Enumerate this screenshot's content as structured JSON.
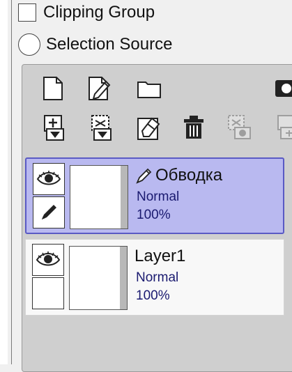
{
  "options": {
    "clipping_group": {
      "label": "Clipping Group",
      "checked": false
    },
    "selection_source": {
      "label": "Selection Source",
      "selected": false
    }
  },
  "toolbar": {
    "row1": [
      "new-layer-icon",
      "new-linework-layer-icon",
      "new-folder-icon",
      "mask-icon"
    ],
    "row2": [
      "transfer-down-icon",
      "merge-down-icon",
      "clear-layer-icon",
      "delete-layer-icon",
      "apply-mask-icon",
      "add-mask-icon"
    ]
  },
  "layers": [
    {
      "name": "Обводка",
      "mode": "Normal",
      "opacity": "100%",
      "selected": true,
      "visible": true,
      "linework": true
    },
    {
      "name": "Layer1",
      "mode": "Normal",
      "opacity": "100%",
      "selected": false,
      "visible": true,
      "linework": false
    }
  ],
  "colors": {
    "selection_fill": "#b9b9f0",
    "selection_border": "#5a5ac4",
    "panel_bg": "#cfcfcf"
  }
}
